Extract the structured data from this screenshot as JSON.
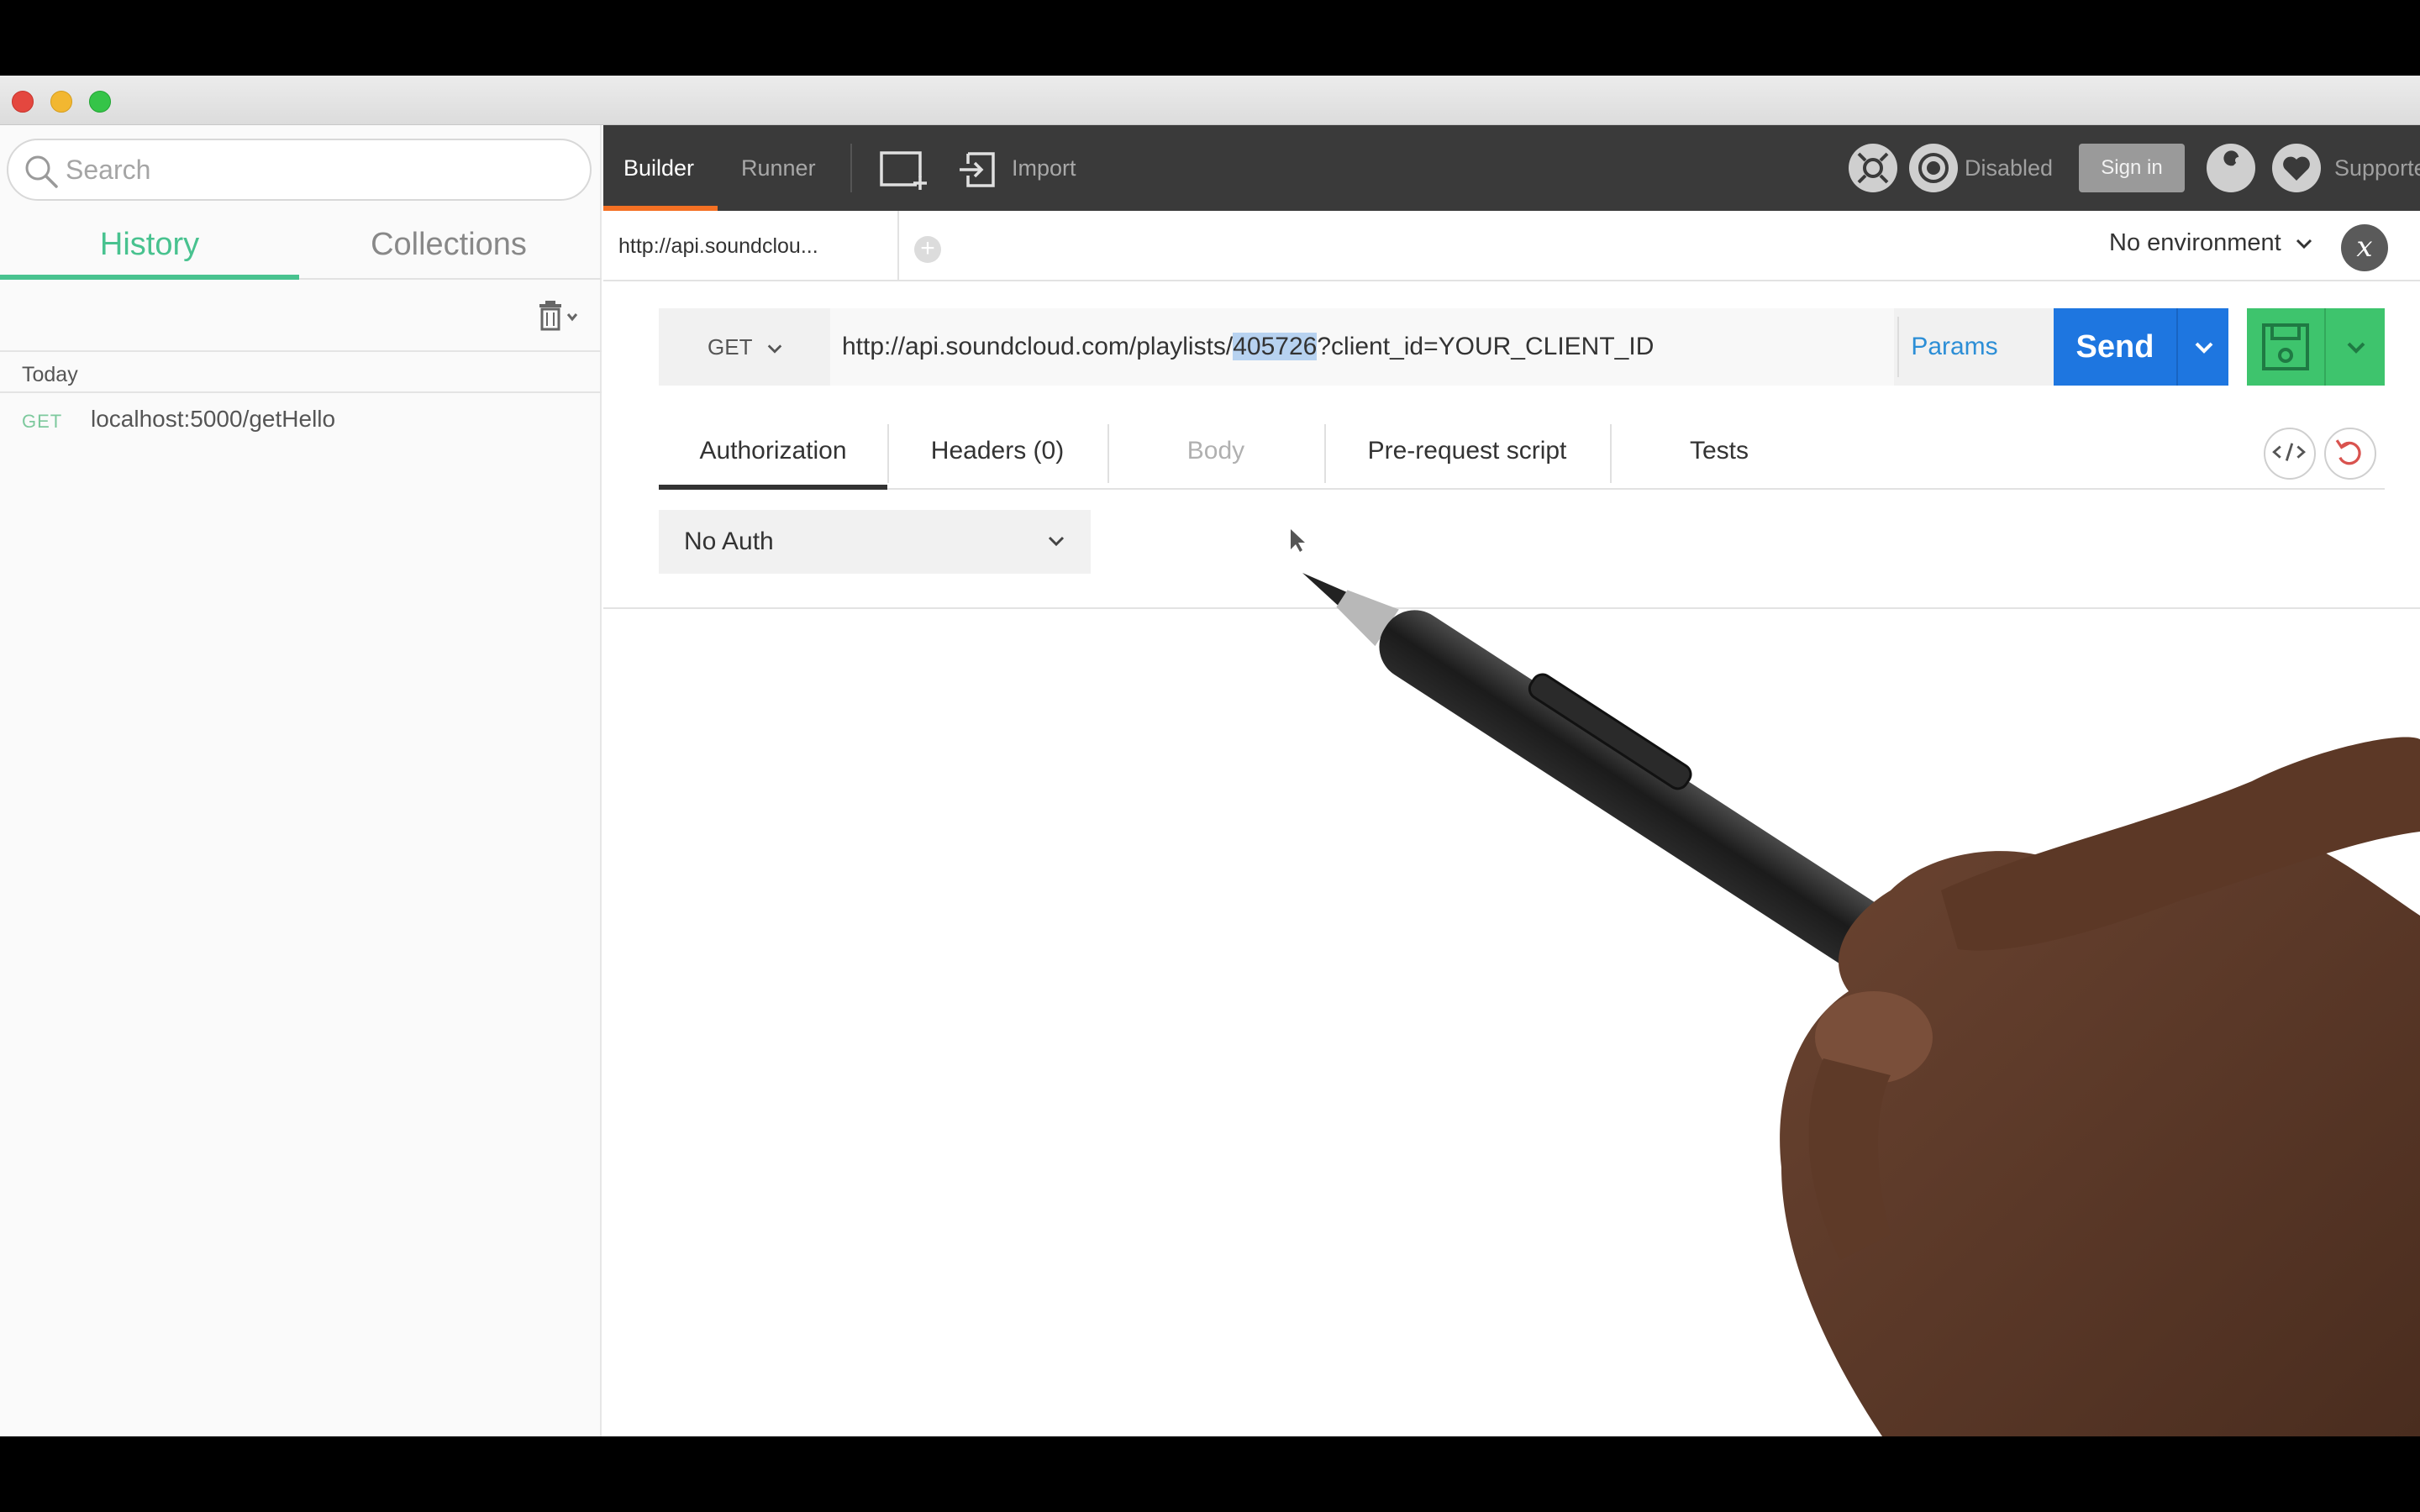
{
  "sidebar": {
    "search_placeholder": "Search",
    "tabs": {
      "history": "History",
      "collections": "Collections"
    },
    "history_groups": [
      {
        "label": "Today",
        "items": [
          {
            "method": "GET",
            "url": "localhost:5000/getHello"
          }
        ]
      }
    ]
  },
  "toolbar": {
    "builder": "Builder",
    "runner": "Runner",
    "import": "Import",
    "interceptor_status": "Disabled",
    "sign_in": "Sign in",
    "supporters": "Supporters"
  },
  "request_tabs": [
    {
      "label": "http://api.soundclou..."
    }
  ],
  "environment": {
    "selected": "No environment",
    "quicklook": "x"
  },
  "request": {
    "method": "GET",
    "url_prefix": "http://api.soundcloud.com/playlists/",
    "url_highlight": "405726",
    "url_suffix": "?client_id=YOUR_CLIENT_ID",
    "params_label": "Params",
    "send_label": "Send"
  },
  "sub_tabs": {
    "authorization": "Authorization",
    "headers": "Headers (0)",
    "body": "Body",
    "prerequest": "Pre-request script",
    "tests": "Tests"
  },
  "auth": {
    "selected": "No Auth"
  },
  "colors": {
    "accent_green": "#48c28f",
    "send_blue": "#1e76e0",
    "save_green": "#3ec46d",
    "toolbar_dark": "#3a3a3a",
    "builder_underline": "#f47023",
    "url_highlight": "#b7d2f0"
  }
}
